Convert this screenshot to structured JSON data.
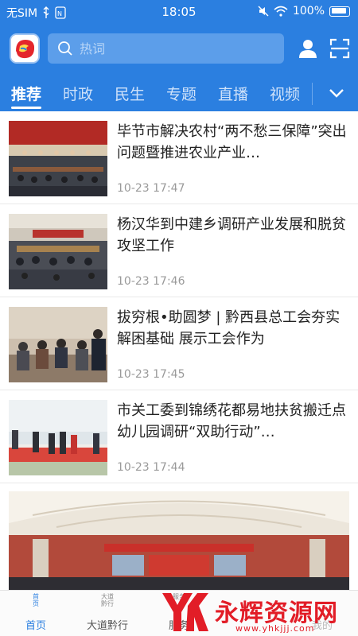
{
  "status_bar": {
    "carrier": "无SIM",
    "time": "18:05",
    "battery": "100%"
  },
  "search": {
    "placeholder": "热词"
  },
  "tabs": [
    {
      "label": "推荐",
      "active": true
    },
    {
      "label": "时政",
      "active": false
    },
    {
      "label": "民生",
      "active": false
    },
    {
      "label": "专题",
      "active": false
    },
    {
      "label": "直播",
      "active": false
    },
    {
      "label": "视频",
      "active": false
    }
  ],
  "news": [
    {
      "title": "毕节市解决农村“两不愁三保障”突出问题暨推进农业产业…",
      "time": "10-23 17:47"
    },
    {
      "title": "杨汉华到中建乡调研产业发展和脱贫攻坚工作",
      "time": "10-23 17:46"
    },
    {
      "title": "拔穷根•助圆梦 | 黔西县总工会夯实解困基础 展示工会作为",
      "time": "10-23 17:45"
    },
    {
      "title": "市关工委到锦绣花都易地扶贫搬迁点幼儿园调研“双助行动”…",
      "time": "10-23 17:44"
    }
  ],
  "bottom_nav": [
    {
      "icon_text": "首\n页",
      "label": "首页",
      "active": true
    },
    {
      "icon_text": "大道\n黔行",
      "label": "大道黔行",
      "active": false
    },
    {
      "icon_text": "服务",
      "label": "服务",
      "active": false
    },
    {
      "icon_text": "",
      "label": "",
      "active": false
    },
    {
      "icon_text": "",
      "label": "我的",
      "active": false
    }
  ],
  "watermark": {
    "text": "永辉资源网",
    "url": "www.yhkjjj.com"
  },
  "colors": {
    "brand_blue": "#2b7fe0",
    "watermark_red": "#e21d27"
  }
}
